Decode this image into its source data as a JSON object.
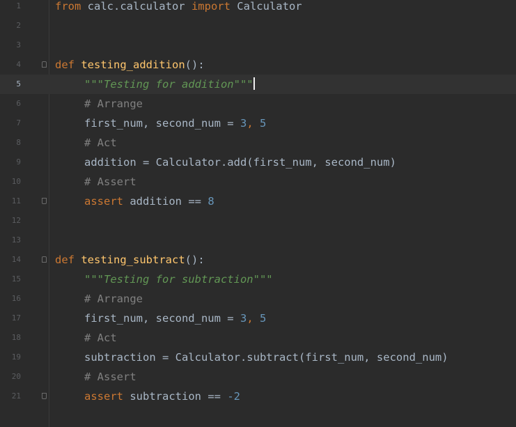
{
  "editor": {
    "current_line": 5,
    "lines": [
      {
        "n": "1"
      },
      {
        "n": "2"
      },
      {
        "n": "3"
      },
      {
        "n": "4"
      },
      {
        "n": "5"
      },
      {
        "n": "6"
      },
      {
        "n": "7"
      },
      {
        "n": "8"
      },
      {
        "n": "9"
      },
      {
        "n": "10"
      },
      {
        "n": "11"
      },
      {
        "n": "12"
      },
      {
        "n": "13"
      },
      {
        "n": "14"
      },
      {
        "n": "15"
      },
      {
        "n": "16"
      },
      {
        "n": "17"
      },
      {
        "n": "18"
      },
      {
        "n": "19"
      },
      {
        "n": "20"
      },
      {
        "n": "21"
      }
    ],
    "code": {
      "l1": {
        "from": "from",
        "module": " calc.calculator ",
        "import": "import",
        "name": " Calculator"
      },
      "l4": {
        "def": "def",
        "name": "testing_addition",
        "rest": "():"
      },
      "l5": {
        "doc": "\"\"\"Testing for addition\"\"\""
      },
      "l6": {
        "comment": "# Arrange"
      },
      "l7": {
        "a": "first_num, second_num = ",
        "n1": "3",
        "sep": ", ",
        "n2": "5"
      },
      "l8": {
        "comment": "# Act"
      },
      "l9": {
        "text": "addition = Calculator.add(first_num, second_num)"
      },
      "l10": {
        "comment": "# Assert"
      },
      "l11": {
        "kw": "assert",
        "rest": " addition == ",
        "num": "8"
      },
      "l14": {
        "def": "def",
        "name": "testing_subtract",
        "rest": "():"
      },
      "l15": {
        "doc": "\"\"\"Testing for subtraction\"\"\""
      },
      "l16": {
        "comment": "# Arrange"
      },
      "l17": {
        "a": "first_num, second_num = ",
        "n1": "3",
        "sep": ", ",
        "n2": "5"
      },
      "l18": {
        "comment": "# Act"
      },
      "l19": {
        "text": "subtraction = Calculator.subtract(first_num, second_num)"
      },
      "l20": {
        "comment": "# Assert"
      },
      "l21": {
        "kw": "assert",
        "rest": " subtraction == ",
        "num": "-2"
      }
    }
  },
  "colors": {
    "background": "#2b2b2b",
    "keyword": "#cc7832",
    "function": "#ffc66d",
    "docstring": "#629755",
    "comment": "#808080",
    "number": "#6897bb",
    "text": "#a9b7c6"
  }
}
